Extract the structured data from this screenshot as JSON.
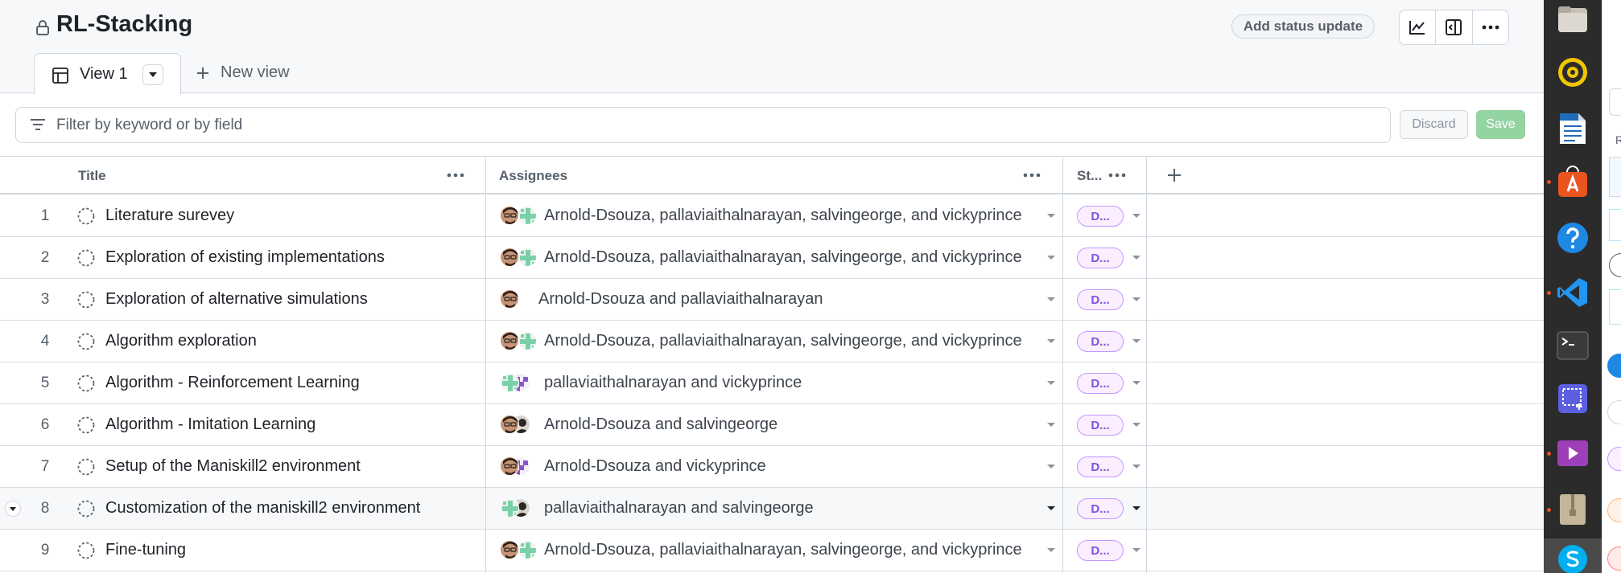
{
  "project": {
    "title": "RL-Stacking"
  },
  "header": {
    "status_update_label": "Add status update",
    "icons": [
      "insights-icon",
      "side-panel-icon",
      "more-options-icon"
    ]
  },
  "views": {
    "active_tab_label": "View 1",
    "new_view_label": "New view"
  },
  "filter": {
    "placeholder": "Filter by keyword or by field",
    "value": "",
    "discard_label": "Discard",
    "save_label": "Save"
  },
  "table": {
    "columns": {
      "title": "Title",
      "assignees": "Assignees",
      "status": "St..."
    },
    "rows": [
      {
        "num": "1",
        "title": "Literature surevey",
        "assignees": "Arnold-Dsouza, pallaviaithalnarayan, salvingeorge, and vickyprince",
        "avatars": [
          "face",
          "identicon-green"
        ],
        "status": "D..."
      },
      {
        "num": "2",
        "title": "Exploration of existing implementations",
        "assignees": "Arnold-Dsouza, pallaviaithalnarayan, salvingeorge, and vickyprince",
        "avatars": [
          "face",
          "identicon-green"
        ],
        "status": "D..."
      },
      {
        "num": "3",
        "title": "Exploration of alternative simulations",
        "assignees": "Arnold-Dsouza and pallaviaithalnarayan",
        "avatars": [
          "face"
        ],
        "status": "D..."
      },
      {
        "num": "4",
        "title": "Algorithm exploration",
        "assignees": "Arnold-Dsouza, pallaviaithalnarayan, salvingeorge, and vickyprince",
        "avatars": [
          "face",
          "identicon-green"
        ],
        "status": "D..."
      },
      {
        "num": "5",
        "title": "Algorithm - Reinforcement Learning",
        "assignees": "pallaviaithalnarayan and vickyprince",
        "avatars": [
          "identicon-green",
          "identicon-purple"
        ],
        "status": "D..."
      },
      {
        "num": "6",
        "title": "Algorithm - Imitation Learning",
        "assignees": "Arnold-Dsouza and salvingeorge",
        "avatars": [
          "face",
          "silhouette"
        ],
        "status": "D..."
      },
      {
        "num": "7",
        "title": "Setup of the Maniskill2 environment",
        "assignees": "Arnold-Dsouza and vickyprince",
        "avatars": [
          "face",
          "identicon-purple"
        ],
        "status": "D..."
      },
      {
        "num": "8",
        "title": "Customization of the maniskill2 environment",
        "assignees": "pallaviaithalnarayan and salvingeorge",
        "avatars": [
          "identicon-green",
          "silhouette"
        ],
        "status": "D..."
      },
      {
        "num": "9",
        "title": "Fine-tuning",
        "assignees": "Arnold-Dsouza, pallaviaithalnarayan, salvingeorge, and vickyprince",
        "avatars": [
          "face",
          "identicon-green"
        ],
        "status": "D..."
      }
    ]
  },
  "dock": {
    "items": [
      "files-icon",
      "rhythmbox-icon",
      "writer-icon",
      "software-center-icon",
      "help-icon",
      "vscode-icon",
      "terminal-icon",
      "screenshot-icon",
      "video-player-icon",
      "archive-icon",
      "skype-icon"
    ]
  },
  "colors": {
    "status_pill_bg": "#fbefff",
    "status_pill_text": "#8250df",
    "save_button": "#94d3a2",
    "dock_bg": "#2b2b2b",
    "header_bg": "#f6f8fa"
  }
}
